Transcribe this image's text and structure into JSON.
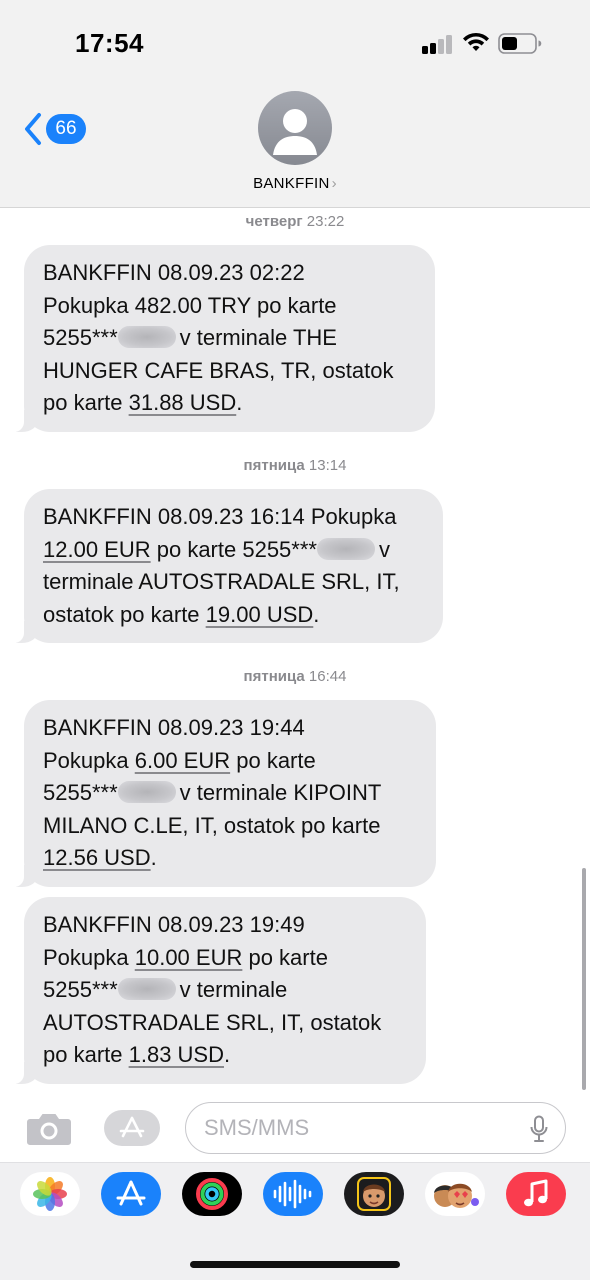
{
  "status_bar": {
    "time": "17:54"
  },
  "header": {
    "back_count": "66",
    "contact_name": "BANKFFIN",
    "contact_chevron": "›"
  },
  "messages": [
    {
      "timestamp_day": "четверг",
      "timestamp_time": "23:22",
      "lines": [
        "BANKFFIN 08.09.23 02:22",
        "Pokupka 482.00 TRY po karte",
        "5255***",
        "v terminale THE",
        "HUNGER CAFE BRAS, TR, ostatok",
        "po karte ",
        "31.88 USD",
        "."
      ]
    },
    {
      "timestamp_day": "пятница",
      "timestamp_time": "13:14",
      "lines": [
        "BANKFFIN 08.09.23 16:14 Pokupka",
        "12.00 EUR",
        " po karte 5255***",
        "v",
        "terminale AUTOSTRADALE SRL, IT,",
        "ostatok po karte ",
        "19.00 USD",
        "."
      ]
    },
    {
      "timestamp_day": "пятница",
      "timestamp_time": "16:44",
      "lines": [
        "BANKFFIN 08.09.23 19:44",
        "Pokupka ",
        "6.00 EUR",
        " po karte",
        "5255***",
        "v terminale KIPOINT",
        "MILANO C.LE, IT, ostatok po karte",
        "12.56 USD",
        "."
      ]
    },
    {
      "lines": [
        "BANKFFIN 08.09.23 19:49",
        "Pokupka ",
        "10.00 EUR",
        " po karte",
        "5255***",
        "v terminale",
        "AUTOSTRADALE SRL, IT, ostatok",
        "po karte ",
        "1.83 USD",
        "."
      ]
    }
  ],
  "composer": {
    "placeholder": "SMS/MMS",
    "camera_icon": "camera-icon",
    "apps_icon": "app-store-icon",
    "mic_icon": "microphone-icon"
  },
  "app_drawer": {
    "apps": [
      "photos",
      "app-store",
      "fitness-activity",
      "audio-messages",
      "memoji",
      "animoji-stickers",
      "music"
    ],
    "colors": {
      "app_store": "#1a82fb",
      "music": "#fa3c4e",
      "activity_ring": "#2fd159"
    }
  },
  "colors": {
    "bubble": "#e9e9eb",
    "accent": "#1a82fb",
    "timestamp": "#8a8a8e"
  }
}
